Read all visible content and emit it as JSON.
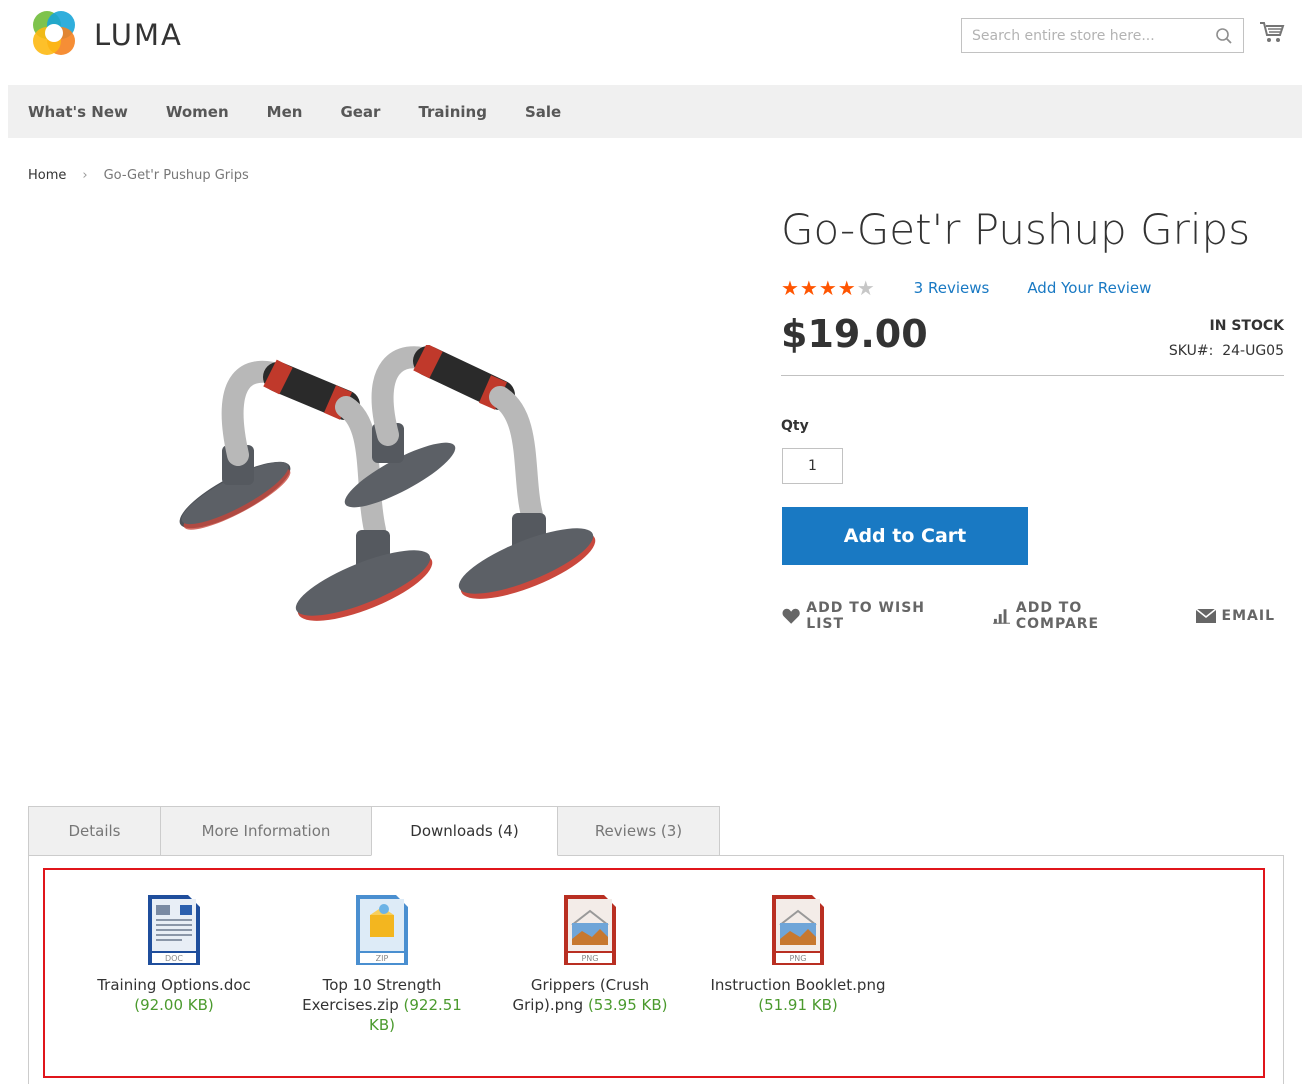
{
  "header": {
    "logo_text": "LUMA",
    "search_placeholder": "Search entire store here..."
  },
  "nav": {
    "items": [
      "What's New",
      "Women",
      "Men",
      "Gear",
      "Training",
      "Sale"
    ]
  },
  "breadcrumb": {
    "home": "Home",
    "separator": "›",
    "current": "Go-Get'r Pushup Grips"
  },
  "product": {
    "title": "Go-Get'r Pushup Grips",
    "rating_stars": 4,
    "rating_max": 5,
    "reviews_link": "3 Reviews",
    "add_review_link": "Add Your Review",
    "price": "$19.00",
    "stock": "IN STOCK",
    "sku_label": "SKU#:",
    "sku_value": "24-UG05",
    "qty_label": "Qty",
    "qty_value": "1",
    "add_to_cart": "Add to Cart",
    "actions": {
      "wishlist": "Add to Wish List",
      "compare": "Add to Compare",
      "email": "Email"
    }
  },
  "tabs": [
    {
      "label": "Details"
    },
    {
      "label": "More Information"
    },
    {
      "label": "Downloads (4)"
    },
    {
      "label": "Reviews (3)"
    }
  ],
  "downloads": [
    {
      "name": "Training Options.doc",
      "size": "(92.00 KB)",
      "type": "DOC",
      "icon": "doc-file-icon"
    },
    {
      "name": "Top 10 Strength Exercises.zip",
      "size": "(922.51 KB)",
      "type": "ZIP",
      "icon": "zip-file-icon"
    },
    {
      "name": "Grippers (Crush Grip).png",
      "size": "(53.95 KB)",
      "type": "PNG",
      "icon": "png-file-icon"
    },
    {
      "name": "Instruction Booklet.png",
      "size": "(51.91 KB)",
      "type": "PNG",
      "icon": "png-file-icon"
    }
  ],
  "colors": {
    "accent_blue": "#1979c3",
    "star_orange": "#ff5501",
    "highlight_red": "#e0151b",
    "size_green": "#4b9a2e"
  }
}
